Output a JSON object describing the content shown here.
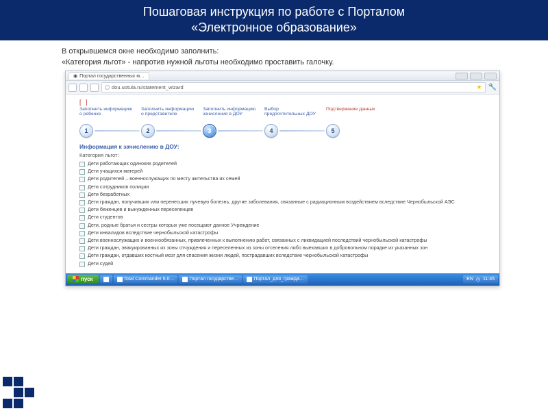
{
  "slide": {
    "title_line1": "Пошаговая инструкция по работе с Порталом",
    "title_line2": "«Электронное образование»",
    "intro1": "В открывшемся окне необходимо заполнить:",
    "intro2": "«Категория льгот» - напротив нужной льготы необходимо проставить галочку."
  },
  "browser": {
    "tab_title": "Портал государственных м…",
    "url": "dou.uotula.ru/statement_wizard",
    "win_buttons": [
      "min",
      "max",
      "close"
    ]
  },
  "wizard": {
    "steps": [
      {
        "num": "1",
        "label": "Заполнить информацию о ребенке"
      },
      {
        "num": "2",
        "label": "Заполнить информацию о представителе"
      },
      {
        "num": "3",
        "label": "Заполнить информацию зачисления в ДОУ",
        "active": true
      },
      {
        "num": "4",
        "label": "Выбор предпочтительных ДОУ"
      },
      {
        "num": "5",
        "label": "Подтвержение данных",
        "accent": true
      }
    ],
    "brackets": "[ ]"
  },
  "form": {
    "section_title": "Информация к зачислению в ДОУ:",
    "subt": "Категория льгот:",
    "items": [
      "Дети работающих одиноких родителей",
      "Дети учащихся матерей",
      "Дети родителей – военнослужащих по месту жительства их семей",
      "Дети сотрудников полиции",
      "Дети безработных",
      "Дети граждан, получивших или перенесших лучевую болезнь, другие заболевания, связанные с радиационным воздействием вследствие Чернобыльской АЭС",
      "Дети беженцев и вынужденных переселенцев",
      "Дети студентов",
      "Дети, родные братья и сестры которых уже посещают данное Учреждение",
      "Дети инвалидов вследствие чернобыльской катастрофы",
      "Дети военнослужащих и военнообязанных, привлеченных к выполнению работ, связанных с ликвидацией последствий чернобыльской катастрофы",
      "Дети граждан, эвакуированных из зоны отчуждения и переселенных из зоны отселения либо выехавших в добровольном порядке из указанных зон",
      "Дети граждан, отдавших костный мозг для спасения жизни людей, пострадавших вследствие чернобыльской катастрофы",
      "Дети судей"
    ]
  },
  "taskbar": {
    "start": "пуск",
    "items": [
      "Total Commander 6.0…",
      "Портал государстве…",
      "Портал_для_гражда…"
    ],
    "tray_lang": "EN",
    "tray_time": "11:45"
  }
}
